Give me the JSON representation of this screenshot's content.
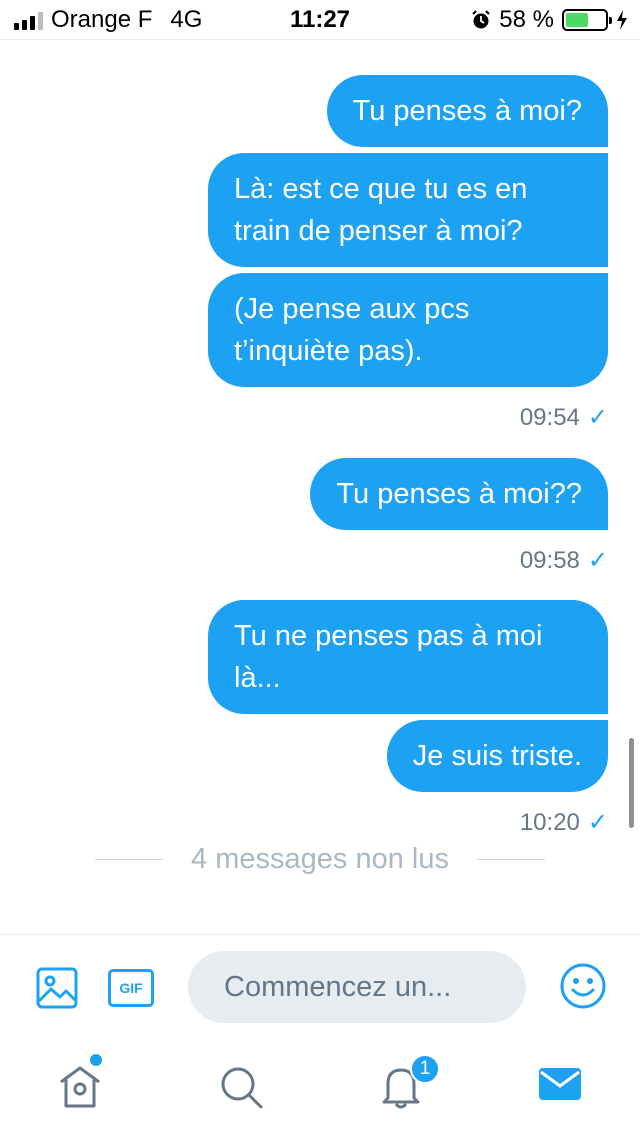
{
  "status_bar": {
    "carrier": "Orange F",
    "network": "4G",
    "time": "11:27",
    "battery_text": "58 %",
    "battery_level": 0.58
  },
  "messages": [
    {
      "bubbles": [
        "Tu penses à moi?",
        "Là: est ce que tu es en train de penser à moi?",
        "(Je pense aux pcs t’inquiète pas)."
      ],
      "time": "09:54"
    },
    {
      "bubbles": [
        "Tu penses à moi??"
      ],
      "time": "09:58"
    },
    {
      "bubbles": [
        "Tu ne penses pas à moi là...",
        "Je suis triste."
      ],
      "time": "10:20"
    }
  ],
  "unread_divider": "4 messages non lus",
  "composer": {
    "gif_label": "GIF",
    "placeholder": "Commencez un..."
  },
  "tab_bar": {
    "notifications_badge": "1"
  },
  "colors": {
    "accent": "#1da1f2",
    "bubble_text": "#ffffff",
    "timestamp": "#657786"
  }
}
